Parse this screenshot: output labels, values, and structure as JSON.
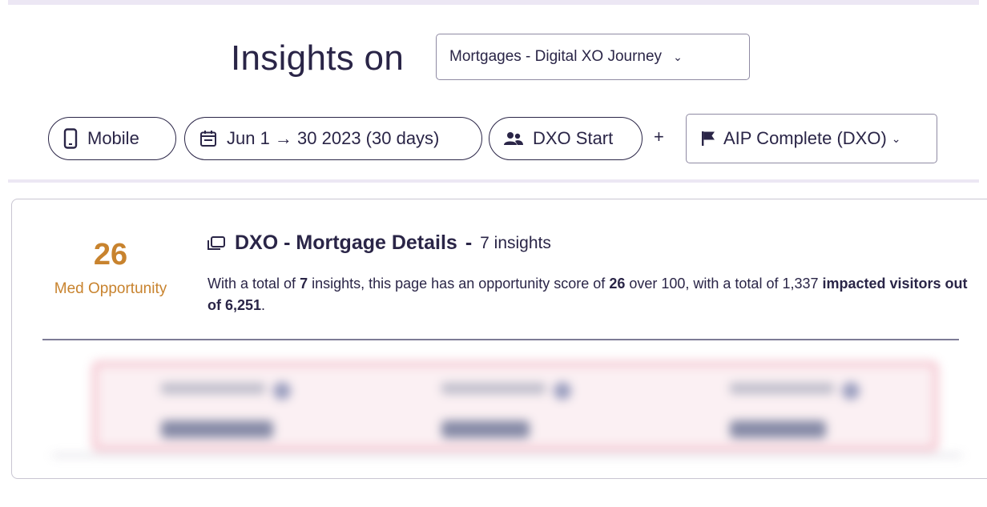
{
  "header": {
    "title": "Insights on",
    "journey_selected": "Mortgages - Digital XO Journey"
  },
  "filters": {
    "device": "Mobile",
    "date_range": "Jun 1 → 30 2023 (30 days)",
    "segment": "DXO Start",
    "plus": "+",
    "goal_selected": "AIP Complete (DXO)"
  },
  "card": {
    "score_value": "26",
    "score_label": "Med Opportunity",
    "page_name": "DXO - Mortgage Details",
    "separator": "-",
    "insights_count": "7 insights",
    "summary": {
      "p1": "With a total of ",
      "n_insights": "7",
      "p2": " insights, this page has an opportunity score of ",
      "score": "26",
      "p3": " over 100, with a total of 1,337 ",
      "impacted": "impacted visitors out of 6,251",
      "p4": "."
    }
  },
  "colors": {
    "text": "#2a2547",
    "opportunity": "#c8832e",
    "border": "#8f8aa3"
  }
}
